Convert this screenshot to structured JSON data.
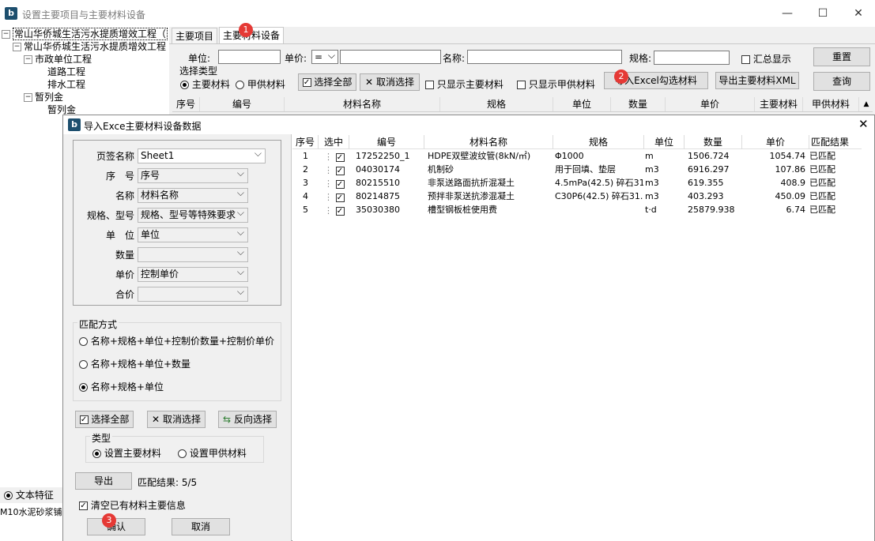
{
  "window": {
    "title": "设置主要项目与主要材料设备",
    "controls": [
      "—",
      "☐",
      "✕"
    ]
  },
  "tree": {
    "items": [
      {
        "label": "常山华侨城生活污水提质增效工程（",
        "level": 0,
        "expander": "−"
      },
      {
        "label": "常山华侨城生活污水提质增效工程",
        "level": 1,
        "expander": "−"
      },
      {
        "label": "市政单位工程",
        "level": 2,
        "expander": "−"
      },
      {
        "label": "道路工程",
        "level": 3,
        "expander": ""
      },
      {
        "label": "排水工程",
        "level": 3,
        "expander": ""
      },
      {
        "label": "暂列金",
        "level": 2,
        "expander": "−"
      },
      {
        "label": "暂列金",
        "level": 3,
        "expander": ""
      }
    ],
    "radio_text": "文本特征",
    "bottom_text": "M10水泥砂浆铺"
  },
  "main": {
    "tabs": [
      "主要项目",
      "主要材料设备"
    ],
    "unit_label": "单位:",
    "price_label": "单价:",
    "price_op": "=",
    "name_label": "名称:",
    "spec_label": "规格:",
    "summary_label": "汇总显示",
    "reset_button": "重置",
    "query_button": "查询",
    "select_type_label": "选择类型",
    "type_main": "主要材料",
    "type_jia": "甲供材料",
    "select_all": "选择全部",
    "cancel_select": "取消选择",
    "only_main": "只显示主要材料",
    "only_jia": "只显示甲供材料",
    "import_excel": "导入Excel勾选材料",
    "export_xml": "导出主要材料XML",
    "grid_headers": [
      "序号",
      "编号",
      "材料名称",
      "规格",
      "单位",
      "数量",
      "单价",
      "主要材料",
      "甲供材料"
    ]
  },
  "dialog": {
    "title": "导入Exce主要材料设备数据",
    "fields": [
      {
        "label": "页签名称",
        "value": "Sheet1",
        "enabled": true
      },
      {
        "label": "序　号",
        "value": "序号",
        "enabled": false
      },
      {
        "label": "名称",
        "value": "材料名称",
        "enabled": false
      },
      {
        "label": "规格、型号",
        "value": "规格、型号等特殊要求",
        "enabled": false
      },
      {
        "label": "单　位",
        "value": "单位",
        "enabled": false
      },
      {
        "label": "数量",
        "value": "",
        "enabled": false
      },
      {
        "label": "单价",
        "value": "控制单价",
        "enabled": false
      },
      {
        "label": "合价",
        "value": "",
        "enabled": false
      }
    ],
    "match_group_label": "匹配方式",
    "match_options": [
      {
        "label": "名称+规格+单位+控制价数量+控制价单价",
        "selected": false
      },
      {
        "label": "名称+规格+单位+数量",
        "selected": false
      },
      {
        "label": "名称+规格+单位",
        "selected": true
      }
    ],
    "select_all": "选择全部",
    "cancel_select": "取消选择",
    "reverse_select": "反向选择",
    "type_group_label": "类型",
    "type_main": "设置主要材料",
    "type_jia": "设置甲供材料",
    "export_button": "导出",
    "match_result": "匹配结果: 5/5",
    "clear_label": "清空已有材料主要信息",
    "confirm_button": "确认",
    "cancel_button": "取消",
    "table_headers": [
      "序号",
      "选中",
      "编号",
      "材料名称",
      "规格",
      "单位",
      "数量",
      "单价",
      "匹配结果"
    ],
    "rows": [
      {
        "no": "1",
        "checked": true,
        "code": "17252250_1",
        "name": "HDPE双壁波纹管(8kN/㎡)",
        "spec": "Φ1000",
        "unit": "m",
        "qty": "1506.724",
        "price": "1054.74",
        "result": "已匹配"
      },
      {
        "no": "2",
        "checked": true,
        "code": "04030174",
        "name": "机制砂",
        "spec": "用于回填、垫层",
        "unit": "m3",
        "qty": "6916.297",
        "price": "107.86",
        "result": "已匹配"
      },
      {
        "no": "3",
        "checked": true,
        "code": "80215510",
        "name": "非泵送路面抗折混凝土",
        "spec": "4.5mPa(42.5) 碎石31.",
        "unit": "m3",
        "qty": "619.355",
        "price": "408.9",
        "result": "已匹配"
      },
      {
        "no": "4",
        "checked": true,
        "code": "80214875",
        "name": "预拌非泵送抗渗混凝土",
        "spec": "C30P6(42.5) 碎石31.",
        "unit": "m3",
        "qty": "403.293",
        "price": "450.09",
        "result": "已匹配"
      },
      {
        "no": "5",
        "checked": true,
        "code": "35030380",
        "name": "槽型钢板桩使用费",
        "spec": "",
        "unit": "t·d",
        "qty": "25879.938",
        "price": "6.74",
        "result": "已匹配"
      }
    ]
  },
  "badges": [
    "1",
    "2",
    "3"
  ]
}
